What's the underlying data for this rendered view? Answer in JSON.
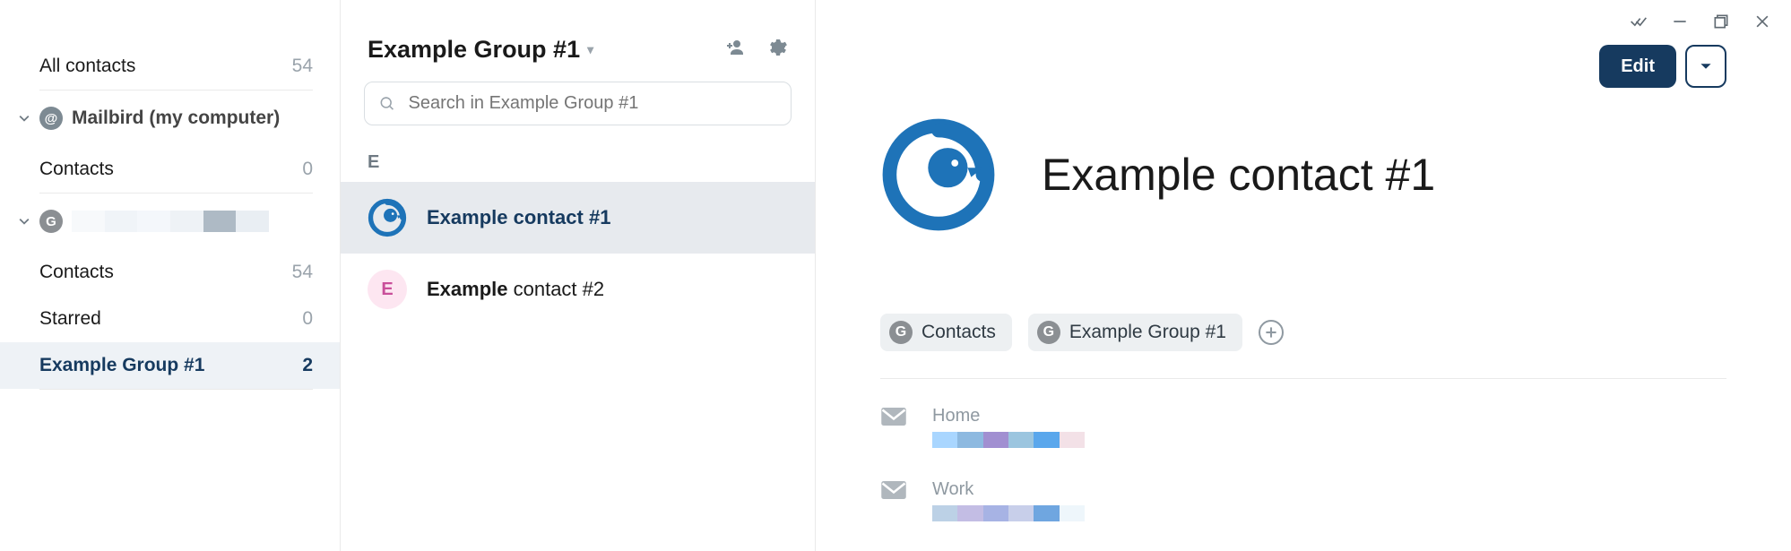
{
  "sidebar": {
    "all": {
      "label": "All contacts",
      "count": "54"
    },
    "groups": [
      {
        "title": "Mailbird (my computer)",
        "iconLetter": "@",
        "rows": [
          {
            "label": "Contacts",
            "count": "0"
          }
        ]
      },
      {
        "title": "",
        "iconLetter": "G",
        "rows": [
          {
            "label": "Contacts",
            "count": "54"
          },
          {
            "label": "Starred",
            "count": "0"
          },
          {
            "label": "Example Group #1",
            "count": "2",
            "selected": true
          }
        ]
      }
    ]
  },
  "mid": {
    "title": "Example Group #1",
    "search_placeholder": "Search in Example Group #1",
    "section_letter": "E",
    "contacts": [
      {
        "name_strong": "Example contact #1",
        "name_rest": "",
        "selected": true,
        "avatar": "mb"
      },
      {
        "name_strong": "Example",
        "name_rest": " contact #2",
        "avatar": "pink",
        "avatar_letter": "E"
      }
    ]
  },
  "detail": {
    "edit_label": "Edit",
    "name": "Example contact #1",
    "chips": [
      "Contacts",
      "Example Group #1"
    ],
    "emails": [
      {
        "label": "Home"
      },
      {
        "label": "Work"
      }
    ]
  }
}
